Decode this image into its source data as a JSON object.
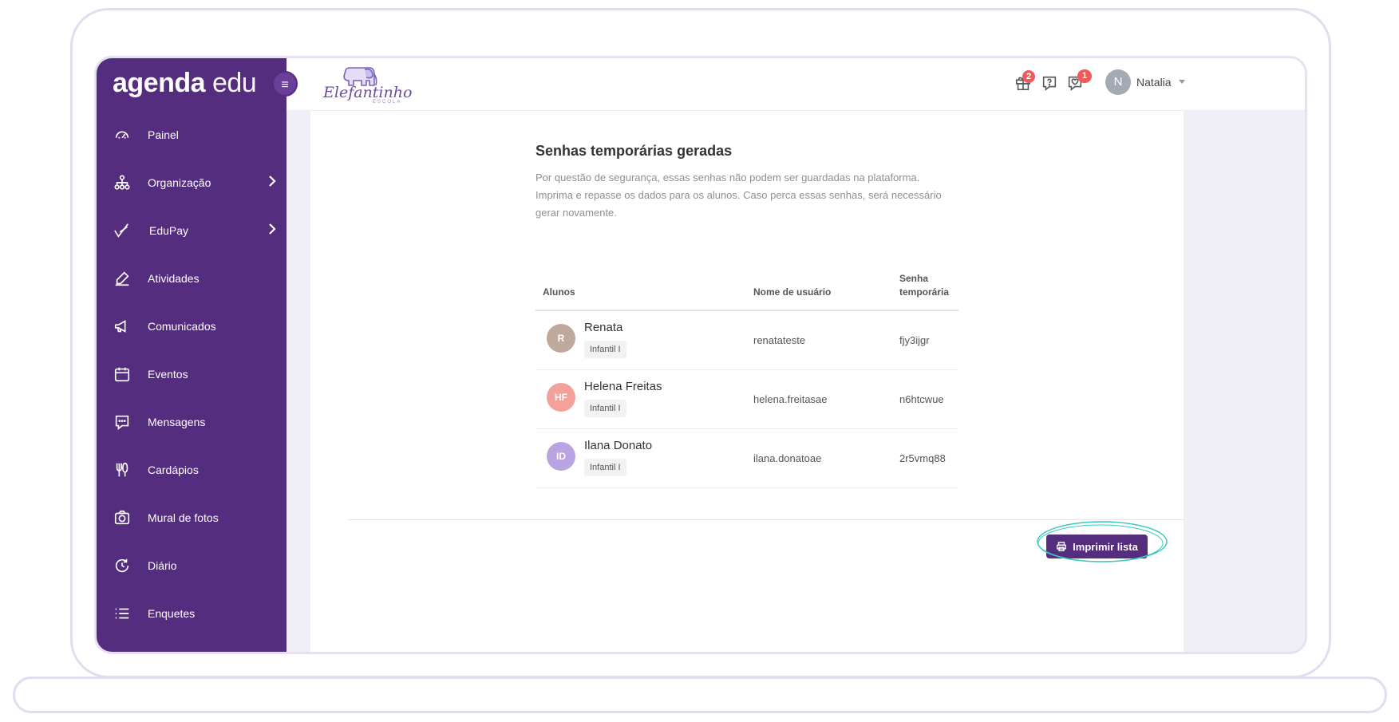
{
  "sidebar": {
    "logo_part1": "agenda",
    "logo_part2": " edu",
    "items": [
      {
        "label": "Painel",
        "icon": "dashboard-gauge-icon"
      },
      {
        "label": "Organização",
        "icon": "organization-tree-icon",
        "has_submenu": true
      },
      {
        "label": "EduPay",
        "icon": "checkmark-pay-icon",
        "has_submenu": true
      },
      {
        "label": "Atividades",
        "icon": "pencil-edit-icon"
      },
      {
        "label": "Comunicados",
        "icon": "megaphone-icon"
      },
      {
        "label": "Eventos",
        "icon": "calendar-icon"
      },
      {
        "label": "Mensagens",
        "icon": "chat-bubble-icon"
      },
      {
        "label": "Cardápios",
        "icon": "cutlery-icon"
      },
      {
        "label": "Mural de fotos",
        "icon": "camera-icon"
      },
      {
        "label": "Diário",
        "icon": "refresh-clock-icon"
      },
      {
        "label": "Enquetes",
        "icon": "list-icon"
      }
    ]
  },
  "header": {
    "school_name": "Elefantinho",
    "school_sub": "ESCOLA",
    "gift_badge": "2",
    "messages_badge": "1",
    "user_initial": "N",
    "user_name": "Natalia"
  },
  "main": {
    "title": "Senhas temporárias geradas",
    "description": "Por questão de segurança, essas senhas não podem ser guardadas na plataforma. Imprima e repasse os dados para os alunos. Caso perca essas senhas, será necessário gerar novamente.",
    "table": {
      "headers": {
        "students": "Alunos",
        "username": "Nome de usuário",
        "password_line1": "Senha",
        "password_line2": "temporária"
      },
      "rows": [
        {
          "initials": "R",
          "name": "Renata",
          "class": "Infantil I",
          "username": "renatateste",
          "password": "fjy3ijgr",
          "color": "#bfa89c"
        },
        {
          "initials": "HF",
          "name": "Helena Freitas",
          "class": "Infantil I",
          "username": "helena.freitasae",
          "password": "n6htcwue",
          "color": "#f4a19a"
        },
        {
          "initials": "ID",
          "name": "Ilana Donato",
          "class": "Infantil I",
          "username": "ilana.donatoae",
          "password": "2r5vmq88",
          "color": "#b9a3e0"
        }
      ]
    },
    "print_button": "Imprimir lista"
  },
  "colors": {
    "sidebar": "#542d7e",
    "accent": "#542d7e",
    "highlight_ring": "#3cc7c0",
    "badge": "#ef5a5a"
  }
}
